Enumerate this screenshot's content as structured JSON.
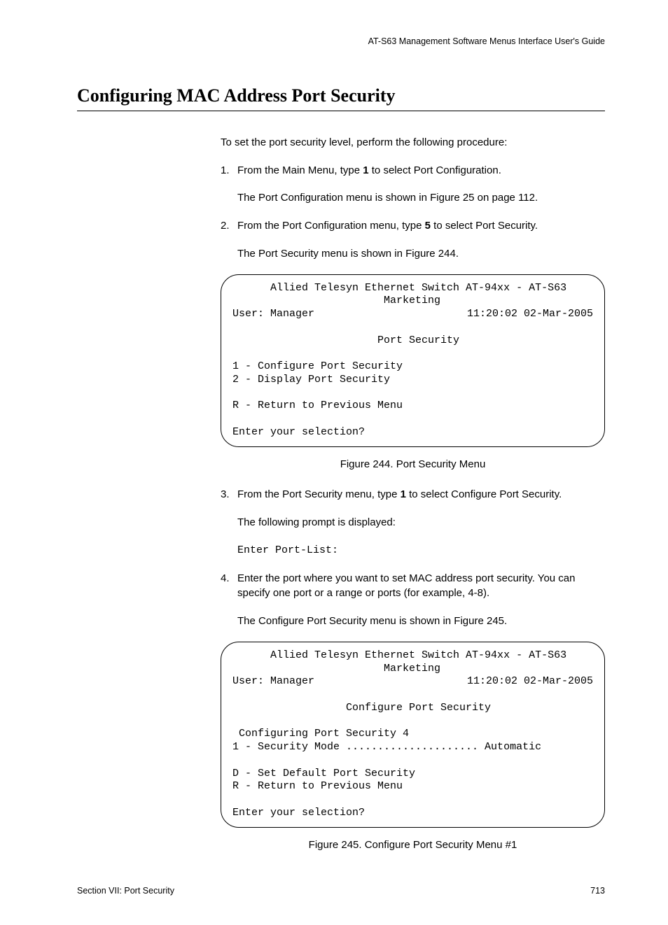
{
  "header": {
    "guide": "AT-S63 Management Software Menus Interface User's Guide"
  },
  "title": "Configuring MAC Address Port Security",
  "intro": "To set the port security level, perform the following procedure:",
  "steps": {
    "s1": {
      "num": "1.",
      "pre": "From the Main Menu, type ",
      "bold": "1",
      "post": " to select Port Configuration.",
      "sub": "The Port Configuration menu is shown in Figure 25 on page 112."
    },
    "s2": {
      "num": "2.",
      "pre": "From the Port Configuration menu, type ",
      "bold": "5",
      "post": " to select Port Security.",
      "sub": "The Port Security menu is shown in Figure 244."
    },
    "s3": {
      "num": "3.",
      "pre": "From the Port Security menu, type ",
      "bold": "1",
      "post": " to select Configure Port Security.",
      "sub": "The following prompt is displayed:",
      "prompt": "Enter Port-List:"
    },
    "s4": {
      "num": "4.",
      "text": "Enter the port where you want to set MAC address port security. You can specify one port or a range or ports (for example, 4-8).",
      "sub": "The Configure Port Security menu is shown in Figure 245."
    }
  },
  "screens": {
    "scr1": {
      "l1": "      Allied Telesyn Ethernet Switch AT-94xx - AT-S63",
      "l2": "                        Marketing",
      "l3l": "User: Manager",
      "l3r": "11:20:02 02-Mar-2005",
      "l4": "                       Port Security",
      "l5": "1 - Configure Port Security",
      "l6": "2 - Display Port Security",
      "l7": "R - Return to Previous Menu",
      "l8": "Enter your selection?"
    },
    "scr2": {
      "l1": "      Allied Telesyn Ethernet Switch AT-94xx - AT-S63",
      "l2": "                        Marketing",
      "l3l": "User: Manager",
      "l3r": "11:20:02 02-Mar-2005",
      "l4": "                  Configure Port Security",
      "l5": " Configuring Port Security 4",
      "l6": "1 - Security Mode ..................... Automatic",
      "l7": "D - Set Default Port Security",
      "l8": "R - Return to Previous Menu",
      "l9": "Enter your selection?"
    }
  },
  "captions": {
    "c1": "Figure 244. Port Security Menu",
    "c2": "Figure 245. Configure Port Security Menu #1"
  },
  "footer": {
    "left": "Section VII: Port Security",
    "right": "713"
  }
}
